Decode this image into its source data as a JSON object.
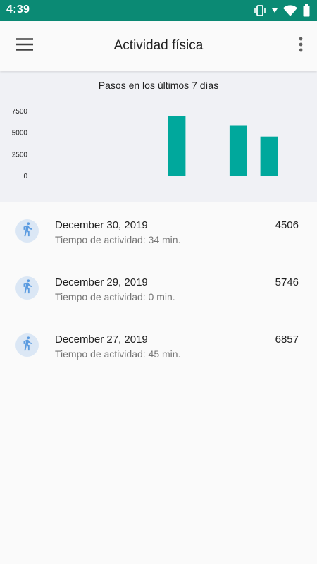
{
  "status_bar": {
    "time": "4:39",
    "icons": [
      "vibrate-icon",
      "signal-arrow-icon",
      "wifi-icon",
      "battery-icon"
    ]
  },
  "app_bar": {
    "title": "Actividad física",
    "menu_icon": "hamburger-menu-icon",
    "overflow_icon": "more-vert-icon"
  },
  "chart_data": {
    "type": "bar",
    "title": "Pasos en los últimos 7 días",
    "categories": [
      "",
      "",
      "",
      "",
      "",
      "",
      "",
      ""
    ],
    "values": [
      0,
      0,
      0,
      0,
      6857,
      0,
      5746,
      4506
    ],
    "ylim": [
      0,
      7500
    ],
    "yticks": [
      "0",
      "2500",
      "5000",
      "7500"
    ],
    "ytick_values": [
      0,
      2500,
      5000,
      7500
    ],
    "bar_color": "#00a89c",
    "axis_color": "#bdbdbd",
    "grid": false
  },
  "activity_list": [
    {
      "date": "December 30, 2019",
      "subtitle": "Tiempo de actividad: 34 min.",
      "steps": "4506",
      "icon": "walking-person-icon"
    },
    {
      "date": "December 29, 2019",
      "subtitle": "Tiempo de actividad: 0 min.",
      "steps": "5746",
      "icon": "walking-person-icon"
    },
    {
      "date": "December 27, 2019",
      "subtitle": "Tiempo de actividad: 45 min.",
      "steps": "6857",
      "icon": "walking-person-icon"
    }
  ],
  "colors": {
    "status_bar": "#0b8a74",
    "accent": "#00a89c",
    "avatar_bg": "#dbe7f5",
    "avatar_icon": "#5b9be0"
  }
}
